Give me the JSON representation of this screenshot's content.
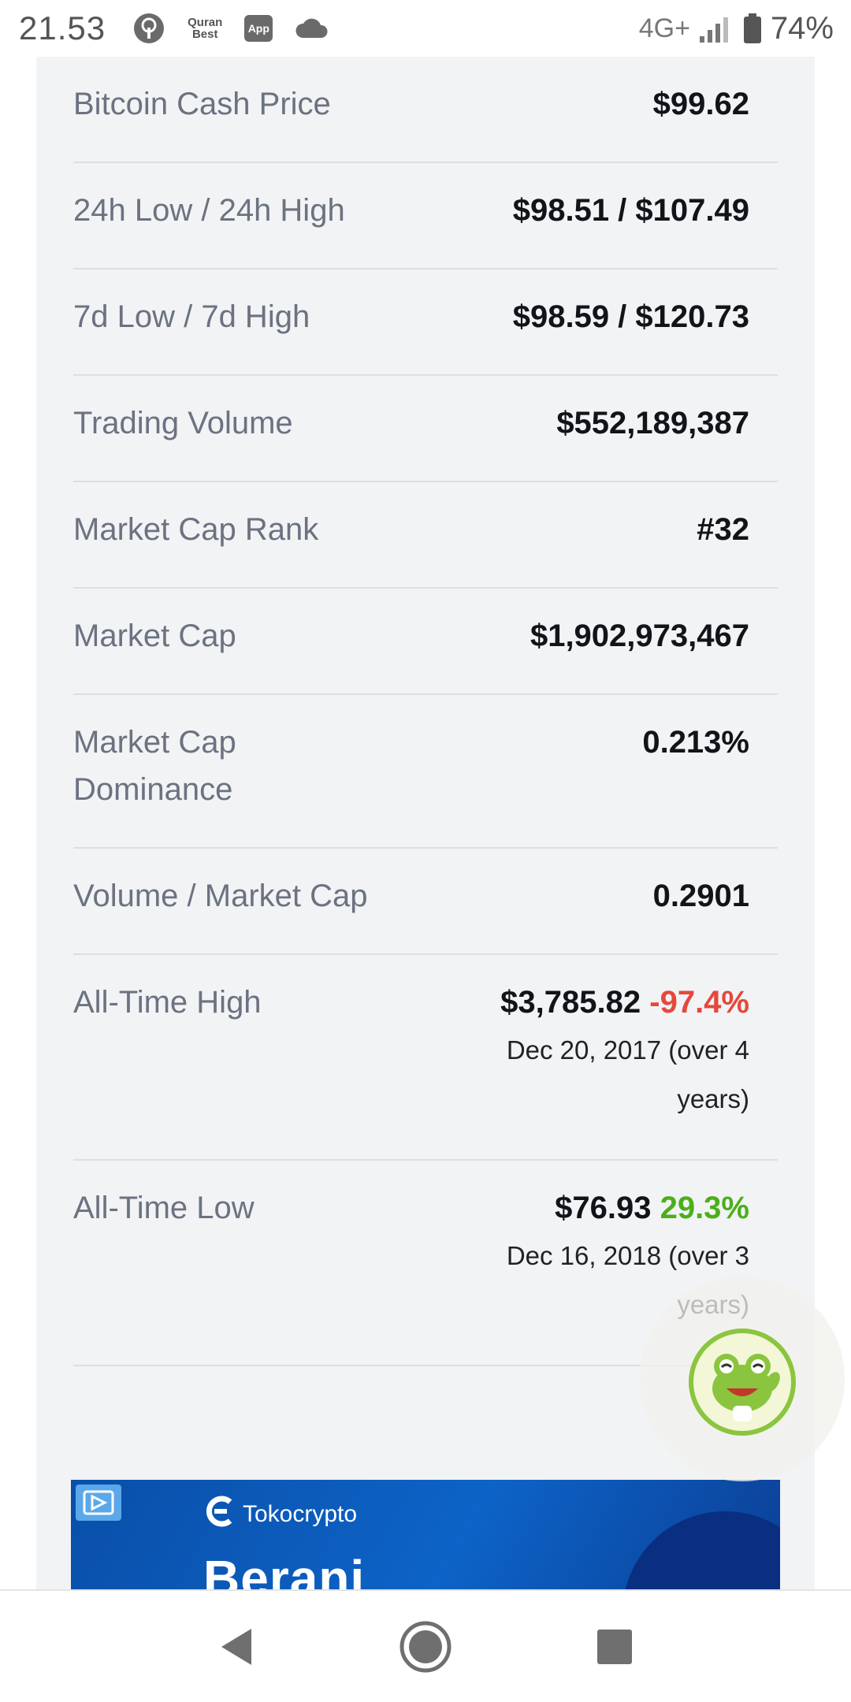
{
  "status_bar": {
    "time": "21.53",
    "quran_app_line1": "Quran",
    "quran_app_line2": "Best",
    "app_badge": "App",
    "network": "4G+",
    "battery": "74%"
  },
  "stats": [
    {
      "label": "Bitcoin Cash Price",
      "value": "$99.62"
    },
    {
      "label": "24h Low / 24h High",
      "value": "$98.51 / $107.49"
    },
    {
      "label": "7d Low / 7d High",
      "value": "$98.59 / $120.73"
    },
    {
      "label": "Trading Volume",
      "value": "$552,189,387"
    },
    {
      "label": "Market Cap Rank",
      "value": "#32"
    },
    {
      "label": "Market Cap",
      "value": "$1,902,973,467"
    },
    {
      "label": "Market Cap Dominance",
      "value": "0.213%"
    },
    {
      "label": "Volume / Market Cap",
      "value": "0.2901"
    }
  ],
  "all_time_high": {
    "label": "All-Time High",
    "value": "$3,785.82",
    "change": "-97.4%",
    "date_line1": "Dec 20, 2017 (over 4",
    "date_line2": "years)"
  },
  "all_time_low": {
    "label": "All-Time Low",
    "value": "$76.93",
    "change": "29.3%",
    "date_line1": "Dec 16, 2018 (over 3",
    "date_line2": "years)"
  },
  "ad": {
    "brand": "Tokocrypto",
    "headline": "Berani"
  },
  "colors": {
    "negative": "#e5483b",
    "positive": "#4caf1a",
    "card_bg": "#f1f3f5",
    "mascot_ring": "#8bc53f"
  }
}
